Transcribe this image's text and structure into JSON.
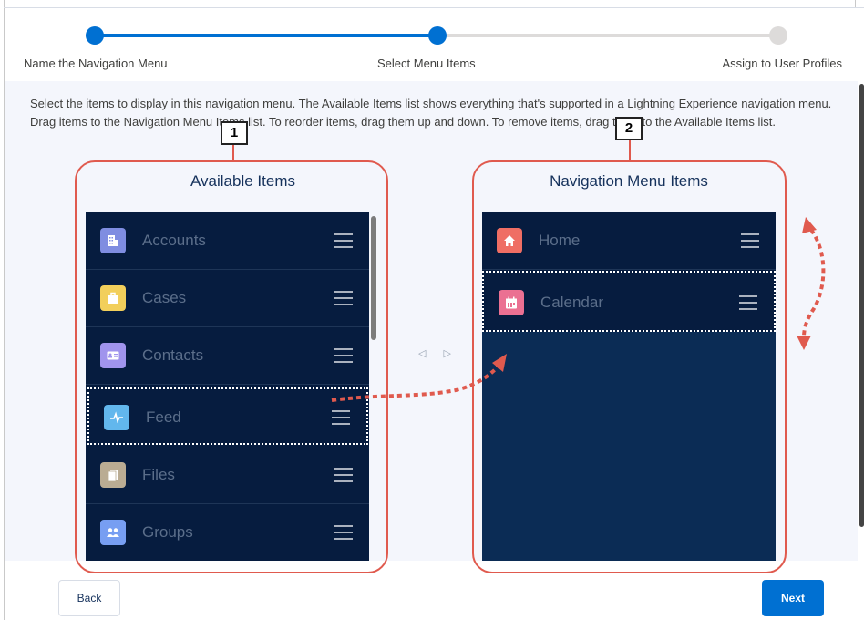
{
  "stepper": {
    "steps": [
      {
        "label": "Name the Navigation Menu",
        "state": "complete"
      },
      {
        "label": "Select Menu Items",
        "state": "current"
      },
      {
        "label": "Assign to User Profiles",
        "state": "upcoming"
      }
    ],
    "colors": {
      "active": "#0070d2",
      "inactive": "#dddbda"
    }
  },
  "instructions": "Select the items to display in this navigation menu. The Available Items list shows everything that's supported in a Lightning Experience navigation menu. Drag items to the Navigation Menu Items list. To reorder items, drag them up and down. To remove items, drag them to the Available Items list.",
  "callouts": {
    "one": "1",
    "two": "2"
  },
  "available": {
    "title": "Available Items",
    "items": [
      {
        "label": "Accounts",
        "icon": "building-icon",
        "color": "#7f8de1"
      },
      {
        "label": "Cases",
        "icon": "briefcase-icon",
        "color": "#f2cf5b"
      },
      {
        "label": "Contacts",
        "icon": "contact-card-icon",
        "color": "#a094ed"
      },
      {
        "label": "Feed",
        "icon": "pulse-icon",
        "color": "#62b7ed",
        "dragging": true
      },
      {
        "label": "Files",
        "icon": "file-icon",
        "color": "#baac93"
      },
      {
        "label": "Groups",
        "icon": "people-icon",
        "color": "#779ef2"
      }
    ]
  },
  "selected": {
    "title": "Navigation Menu Items",
    "items": [
      {
        "label": "Home",
        "icon": "home-icon",
        "color": "#ef6e64"
      },
      {
        "label": "Calendar",
        "icon": "calendar-icon",
        "color": "#eb7092",
        "dragging": true
      }
    ]
  },
  "move_arrows": "◁ ▷",
  "buttons": {
    "back": "Back",
    "next": "Next"
  },
  "annotation_color": "#e05a4e"
}
